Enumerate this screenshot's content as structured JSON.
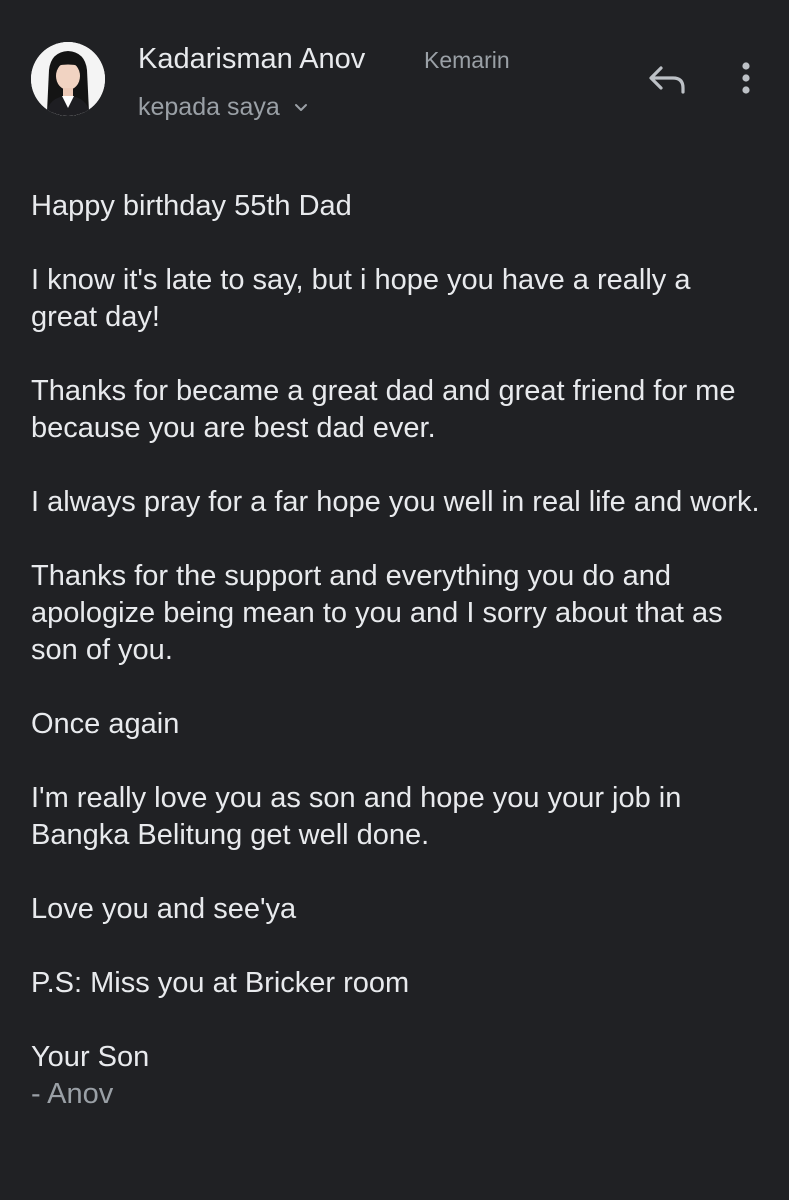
{
  "email": {
    "sender_name": "Kadarisman Anov",
    "date": "Kemarin",
    "recipient_label": "kepada saya",
    "avatar_icon": "person-avatar",
    "reply_icon": "reply-icon",
    "more_icon": "more-vert-icon"
  },
  "body": {
    "p1": "Happy birthday 55th Dad",
    "p2": "I know it's late to say, but i hope you have a really a great day!",
    "p3": "Thanks for became a great dad and great friend for me because you are best dad ever.",
    "p4": "I always pray for a far hope you well in real life and work.",
    "p5": "Thanks for the support and everything you do and apologize being mean to you and I sorry about that as son of you.",
    "p6": "Once again",
    "p7": "I'm really love you as son and hope you your job in Bangka Belitung get well done.",
    "p8": "Love you and see'ya",
    "p9": "P.S: Miss you at Bricker room",
    "closing": "Your Son",
    "signature": "- Anov"
  },
  "colors": {
    "background": "#202124",
    "text_primary": "#e8eaed",
    "text_secondary": "#9aa0a6"
  }
}
